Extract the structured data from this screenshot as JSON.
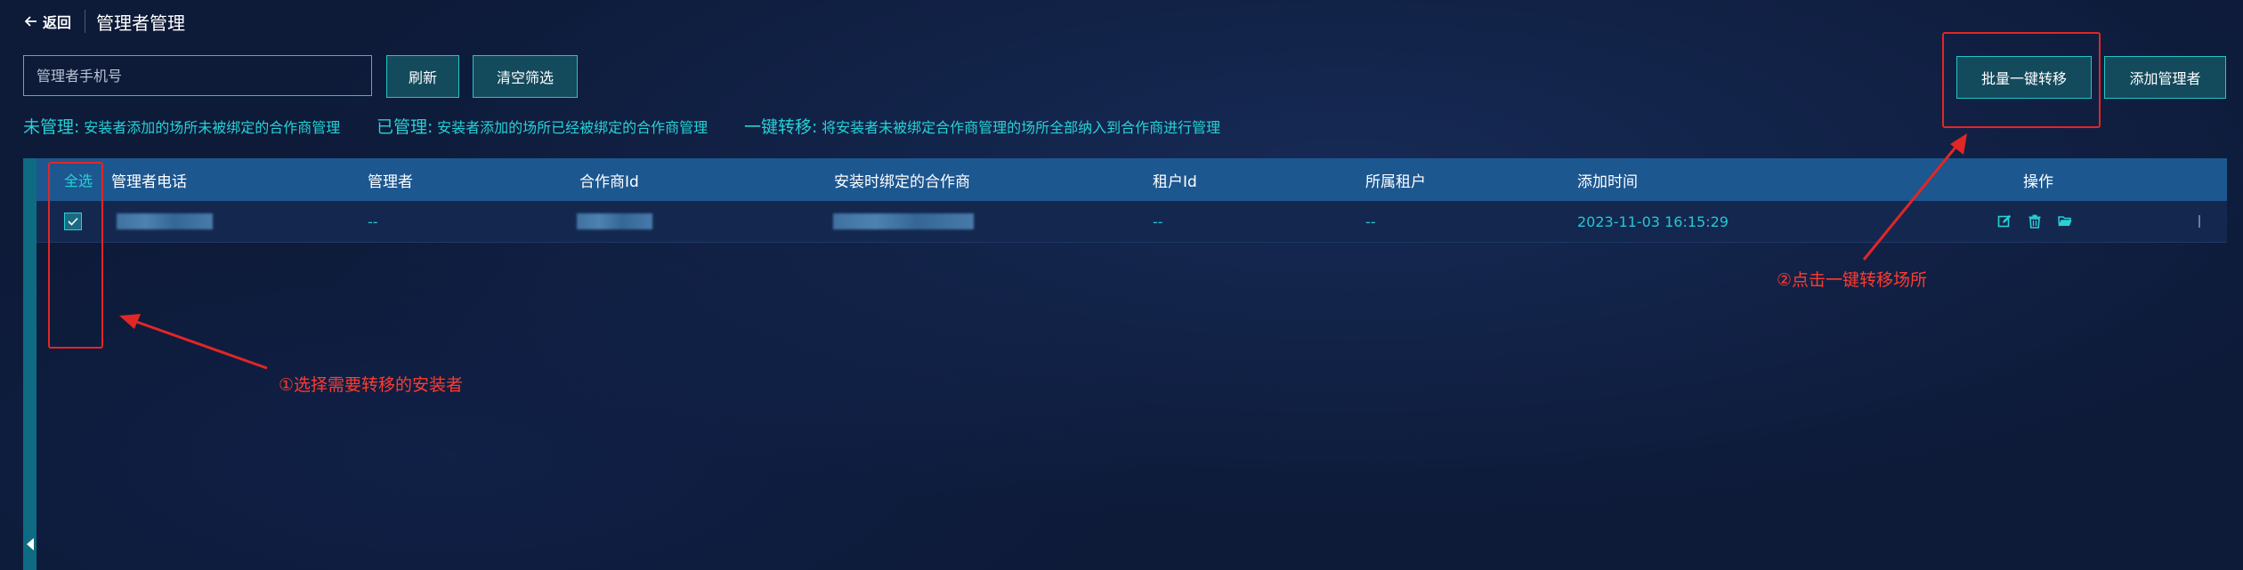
{
  "header": {
    "back_label": "返回",
    "page_title": "管理者管理"
  },
  "search": {
    "placeholder": "管理者手机号"
  },
  "toolbar": {
    "refresh_label": "刷新",
    "clear_label": "清空筛选",
    "batch_transfer_label": "批量一键转移",
    "add_manager_label": "添加管理者"
  },
  "legend": {
    "items": [
      {
        "term": "未管理:",
        "desc": "安装者添加的场所未被绑定的合作商管理"
      },
      {
        "term": "已管理:",
        "desc": "安装者添加的场所已经被绑定的合作商管理"
      },
      {
        "term": "一键转移:",
        "desc": "将安装者未被绑定合作商管理的场所全部纳入到合作商进行管理"
      }
    ]
  },
  "table": {
    "select_all_label": "全选",
    "columns": [
      "管理者电话",
      "管理者",
      "合作商Id",
      "安装时绑定的合作商",
      "租户Id",
      "所属租户",
      "添加时间",
      "操作"
    ],
    "rows": [
      {
        "checked": true,
        "phone": "",
        "manager": "--",
        "partner_id": "",
        "bound_partner": "",
        "tenant_id": "--",
        "tenant": "--",
        "added_time": "2023-11-03 16:15:29"
      }
    ]
  },
  "annotations": {
    "step1": "①选择需要转移的安装者",
    "step2": "②点击一键转移场所"
  },
  "colors": {
    "accent": "#27d1d6",
    "header_bg": "#1d5790",
    "annotation": "#e22626"
  },
  "icons": {
    "back": "arrow-left-icon",
    "edit": "edit-icon",
    "delete": "trash-icon",
    "folder": "folder-open-icon",
    "check": "check-icon",
    "collapse": "caret-left-icon"
  }
}
